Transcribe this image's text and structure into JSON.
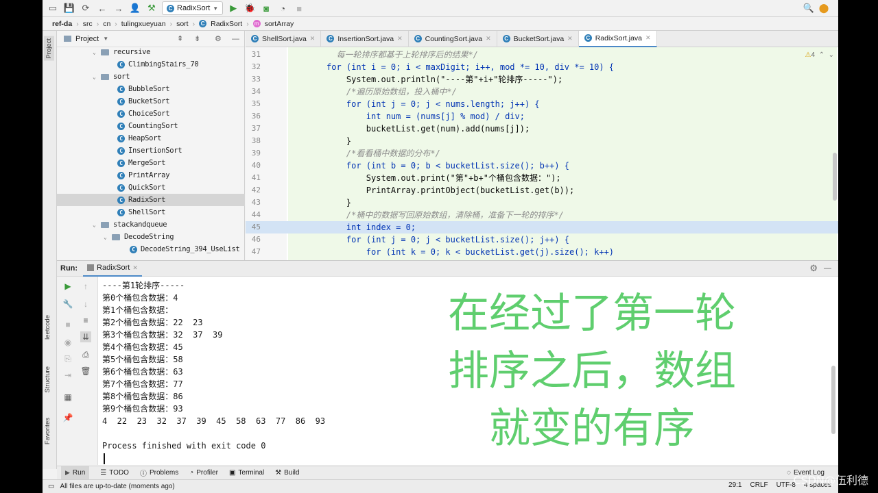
{
  "toolbar": {
    "run_config": "RadixSort"
  },
  "breadcrumb": [
    "ref-da",
    "src",
    "cn",
    "tulingxueyuan",
    "sort",
    "RadixSort",
    "sortArray"
  ],
  "project_panel": {
    "title": "Project",
    "items": [
      {
        "label": "recursive",
        "type": "folder",
        "level": 1
      },
      {
        "label": "ClimbingStairs_70",
        "type": "class",
        "level": 2
      },
      {
        "label": "sort",
        "type": "folder",
        "level": 1
      },
      {
        "label": "BubbleSort",
        "type": "class",
        "level": 2
      },
      {
        "label": "BucketSort",
        "type": "class",
        "level": 2
      },
      {
        "label": "ChoiceSort",
        "type": "class",
        "level": 2
      },
      {
        "label": "CountingSort",
        "type": "class",
        "level": 2
      },
      {
        "label": "HeapSort",
        "type": "class",
        "level": 2
      },
      {
        "label": "InsertionSort",
        "type": "class",
        "level": 2
      },
      {
        "label": "MergeSort",
        "type": "class",
        "level": 2
      },
      {
        "label": "PrintArray",
        "type": "class",
        "level": 2
      },
      {
        "label": "QuickSort",
        "type": "class",
        "level": 2
      },
      {
        "label": "RadixSort",
        "type": "class",
        "level": 2,
        "selected": true
      },
      {
        "label": "ShellSort",
        "type": "class",
        "level": 2
      },
      {
        "label": "stackandqueue",
        "type": "folder",
        "level": 1
      },
      {
        "label": "DecodeString",
        "type": "folder",
        "level": 2
      },
      {
        "label": "DecodeString_394_UseList",
        "type": "class",
        "level": 3
      }
    ]
  },
  "editor_tabs": [
    "ShellSort.java",
    "InsertionSort.java",
    "CountingSort.java",
    "BucketSort.java",
    "RadixSort.java"
  ],
  "active_tab": "RadixSort.java",
  "warnings_count": "4",
  "code_lines": [
    {
      "n": "31",
      "text": "  每一轮排序都基于上轮排序后的结果*/"
    },
    {
      "n": "32",
      "text": "for (int i = 0; i < maxDigit; i++, mod *= 10, div *= 10) {"
    },
    {
      "n": "33",
      "text": "    System.out.println(\"----第\"+i+\"轮排序-----\");"
    },
    {
      "n": "34",
      "text": "    /*遍历原始数组，投入桶中*/"
    },
    {
      "n": "35",
      "text": "    for (int j = 0; j < nums.length; j++) {"
    },
    {
      "n": "36",
      "text": "        int num = (nums[j] % mod) / div;"
    },
    {
      "n": "37",
      "text": "        bucketList.get(num).add(nums[j]);"
    },
    {
      "n": "38",
      "text": "    }"
    },
    {
      "n": "39",
      "text": "    /*看看桶中数据的分布*/"
    },
    {
      "n": "40",
      "text": "    for (int b = 0; b < bucketList.size(); b++) {"
    },
    {
      "n": "41",
      "text": "        System.out.print(\"第\"+b+\"个桶包含数据：\");"
    },
    {
      "n": "42",
      "text": "        PrintArray.printObject(bucketList.get(b));"
    },
    {
      "n": "43",
      "text": "    }"
    },
    {
      "n": "44",
      "text": "    /*桶中的数据写回原始数组，清除桶，准备下一轮的排序*/"
    },
    {
      "n": "45",
      "text": "    int index = 0;"
    },
    {
      "n": "46",
      "text": "    for (int j = 0; j < bucketList.size(); j++) {"
    },
    {
      "n": "47",
      "text": "        for (int k = 0; k < bucketList.get(j).size(); k++)"
    }
  ],
  "run_panel": {
    "label": "Run:",
    "tab": "RadixSort"
  },
  "console_lines": [
    "----第1轮排序-----",
    "第0个桶包含数据：4",
    "第1个桶包含数据：",
    "第2个桶包含数据：22  23",
    "第3个桶包含数据：32  37  39",
    "第4个桶包含数据：45",
    "第5个桶包含数据：58",
    "第6个桶包含数据：63",
    "第7个桶包含数据：77",
    "第8个桶包含数据：86",
    "第9个桶包含数据：93",
    "4  22  23  32  37  39  45  58  63  77  86  93",
    "",
    "Process finished with exit code 0"
  ],
  "overlay_text": [
    "在经过了第一轮",
    "排序之后，数组",
    "就变的有序"
  ],
  "left_strip_tabs": [
    "Project",
    "leetcode",
    "Structure",
    "Favorites"
  ],
  "bottom_tabs": [
    "Run",
    "TODO",
    "Problems",
    "Profiler",
    "Terminal",
    "Build"
  ],
  "event_log": "Event Log",
  "status": {
    "message": "All files are up-to-date (moments ago)",
    "position": "29:1",
    "line_sep": "CRLF",
    "encoding": "UTF-8",
    "indent": "4 spaces"
  },
  "watermark": "CSDN@伍利德",
  "colors": {
    "overlay_green": "#5fce6e",
    "highlight_line": "#d3e3f5",
    "keyword": "#0033b3"
  }
}
